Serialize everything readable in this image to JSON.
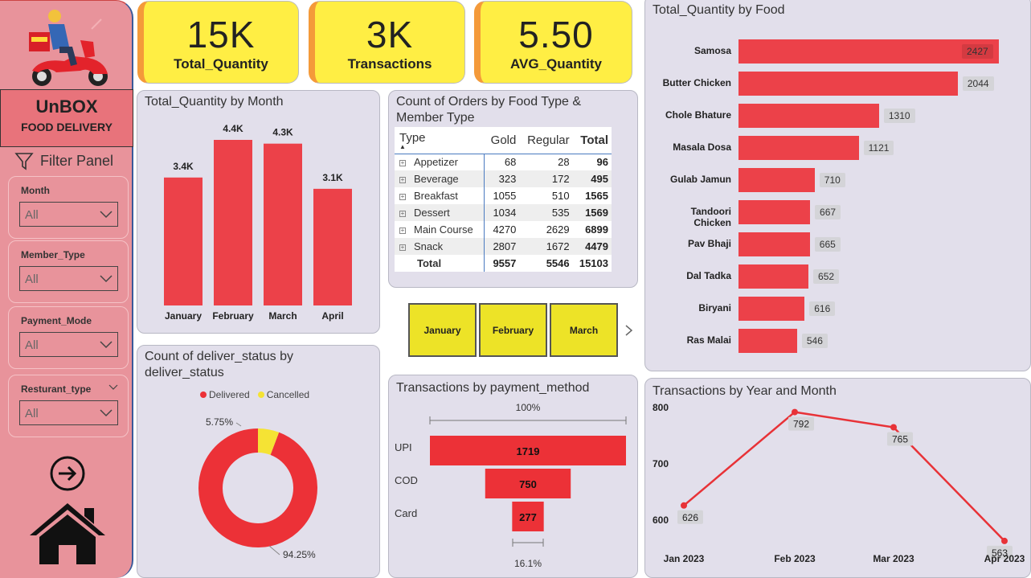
{
  "sidebar": {
    "brand_title": "UnBOX",
    "brand_subtitle": "FOOD DELIVERY",
    "filter_panel": "Filter Panel",
    "slicers": [
      {
        "label": "Month",
        "value": "All"
      },
      {
        "label": "Member_Type",
        "value": "All"
      },
      {
        "label": "Payment_Mode",
        "value": "All"
      },
      {
        "label": "Resturant_type",
        "value": "All"
      }
    ]
  },
  "cards": [
    {
      "value": "15K",
      "label": "Total_Quantity"
    },
    {
      "value": "3K",
      "label": "Transactions"
    },
    {
      "value": "5.50",
      "label": "AVG_Quantity"
    }
  ],
  "month_chart": {
    "title": "Total_Quantity by Month",
    "categories": [
      "January",
      "February",
      "March",
      "April"
    ],
    "labels": [
      "3.4K",
      "4.4K",
      "4.3K",
      "3.1K"
    ],
    "values": [
      3400,
      4400,
      4300,
      3100
    ],
    "color": "#ec4149"
  },
  "matrix": {
    "title": "Count of Orders by Food Type & Member Type",
    "headers": [
      "Type",
      "Gold",
      "Regular",
      "Total"
    ],
    "rows": [
      [
        "Appetizer",
        "68",
        "28",
        "96"
      ],
      [
        "Beverage",
        "323",
        "172",
        "495"
      ],
      [
        "Breakfast",
        "1055",
        "510",
        "1565"
      ],
      [
        "Dessert",
        "1034",
        "535",
        "1569"
      ],
      [
        "Main Course",
        "4270",
        "2629",
        "6899"
      ],
      [
        "Snack",
        "2807",
        "1672",
        "4479"
      ]
    ],
    "total": [
      "Total",
      "9557",
      "5546",
      "15103"
    ]
  },
  "month_buttons": [
    "January",
    "February",
    "March"
  ],
  "food_chart": {
    "title": "Total_Quantity by Food",
    "categories": [
      "Samosa",
      "Butter Chicken",
      "Chole Bhature",
      "Masala Dosa",
      "Gulab Jamun",
      "Tandoori Chicken",
      "Pav Bhaji",
      "Dal Tadka",
      "Biryani",
      "Ras Malai"
    ],
    "values": [
      2427,
      2044,
      1310,
      1121,
      710,
      667,
      665,
      652,
      616,
      546
    ]
  },
  "donut": {
    "title": "Count of deliver_status by deliver_status",
    "legend": [
      "Delivered",
      "Cancelled"
    ],
    "colors": [
      "#ec3137",
      "#f5e334"
    ],
    "values": [
      94.25,
      5.75
    ],
    "labels": [
      "94.25%",
      "5.75%"
    ]
  },
  "funnel": {
    "title": "Transactions by payment_method",
    "top_label": "100%",
    "bottom_label": "16.1%",
    "categories": [
      "UPI",
      "COD",
      "Card"
    ],
    "values": [
      1719,
      750,
      277
    ]
  },
  "line_chart": {
    "title": "Transactions by Year and Month",
    "x": [
      "Jan 2023",
      "Feb 2023",
      "Mar 2023",
      "Apr 2023"
    ],
    "y": [
      626,
      792,
      765,
      563
    ],
    "yticks": [
      "800",
      "700",
      "600"
    ],
    "ylim": [
      560,
      800
    ]
  },
  "chart_data": [
    {
      "type": "bar",
      "title": "Total_Quantity by Month",
      "categories": [
        "January",
        "February",
        "March",
        "April"
      ],
      "values": [
        3400,
        4400,
        4300,
        3100
      ]
    },
    {
      "type": "bar",
      "title": "Total_Quantity by Food",
      "categories": [
        "Samosa",
        "Butter Chicken",
        "Chole Bhature",
        "Masala Dosa",
        "Gulab Jamun",
        "Tandoori Chicken",
        "Pav Bhaji",
        "Dal Tadka",
        "Biryani",
        "Ras Malai"
      ],
      "values": [
        2427,
        2044,
        1310,
        1121,
        710,
        667,
        665,
        652,
        616,
        546
      ]
    },
    {
      "type": "pie",
      "title": "Count of deliver_status by deliver_status",
      "categories": [
        "Delivered",
        "Cancelled"
      ],
      "values": [
        94.25,
        5.75
      ]
    },
    {
      "type": "bar",
      "title": "Transactions by payment_method",
      "categories": [
        "UPI",
        "COD",
        "Card"
      ],
      "values": [
        1719,
        750,
        277
      ]
    },
    {
      "type": "line",
      "title": "Transactions by Year and Month",
      "x": [
        "Jan 2023",
        "Feb 2023",
        "Mar 2023",
        "Apr 2023"
      ],
      "y": [
        626,
        792,
        765,
        563
      ]
    }
  ]
}
